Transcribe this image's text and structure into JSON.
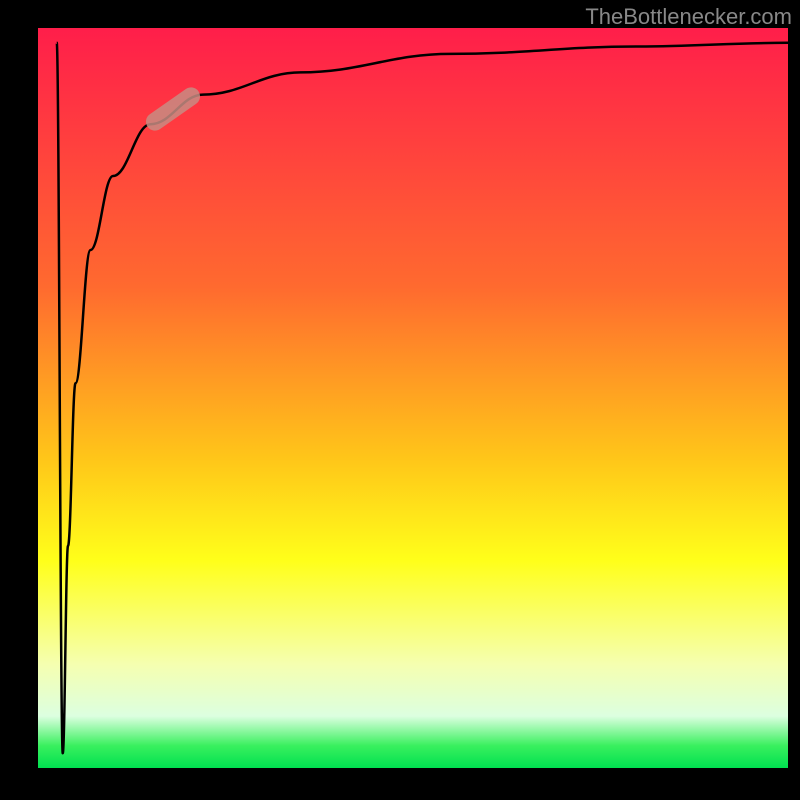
{
  "watermark": "TheBottlenecker.com",
  "chart_data": {
    "type": "line",
    "title": "",
    "xlabel": "",
    "ylabel": "",
    "x_range": [
      0,
      100
    ],
    "y_range": [
      0,
      100
    ],
    "gradient_stops": [
      {
        "pct": 0,
        "color": "#ff1e4a"
      },
      {
        "pct": 35,
        "color": "#ff6a2f"
      },
      {
        "pct": 58,
        "color": "#ffc519"
      },
      {
        "pct": 72,
        "color": "#ffff1a"
      },
      {
        "pct": 86,
        "color": "#f5ffb0"
      },
      {
        "pct": 93,
        "color": "#dcffe0"
      },
      {
        "pct": 97,
        "color": "#39f05e"
      },
      {
        "pct": 100,
        "color": "#00e050"
      }
    ],
    "series": [
      {
        "name": "bottleneck-curve",
        "description": "Dip from top to near-bottom then logarithmic rise back toward top",
        "points": [
          {
            "x": 2.5,
            "y": 98
          },
          {
            "x": 3.3,
            "y": 2
          },
          {
            "x": 4.0,
            "y": 30
          },
          {
            "x": 5.0,
            "y": 52
          },
          {
            "x": 7.0,
            "y": 70
          },
          {
            "x": 10.0,
            "y": 80
          },
          {
            "x": 15.0,
            "y": 87
          },
          {
            "x": 22.0,
            "y": 91
          },
          {
            "x": 35.0,
            "y": 94
          },
          {
            "x": 55.0,
            "y": 96.5
          },
          {
            "x": 80.0,
            "y": 97.5
          },
          {
            "x": 100.0,
            "y": 98
          }
        ]
      }
    ],
    "highlight": {
      "x": 18,
      "y": 89,
      "angle_deg": -35
    }
  }
}
